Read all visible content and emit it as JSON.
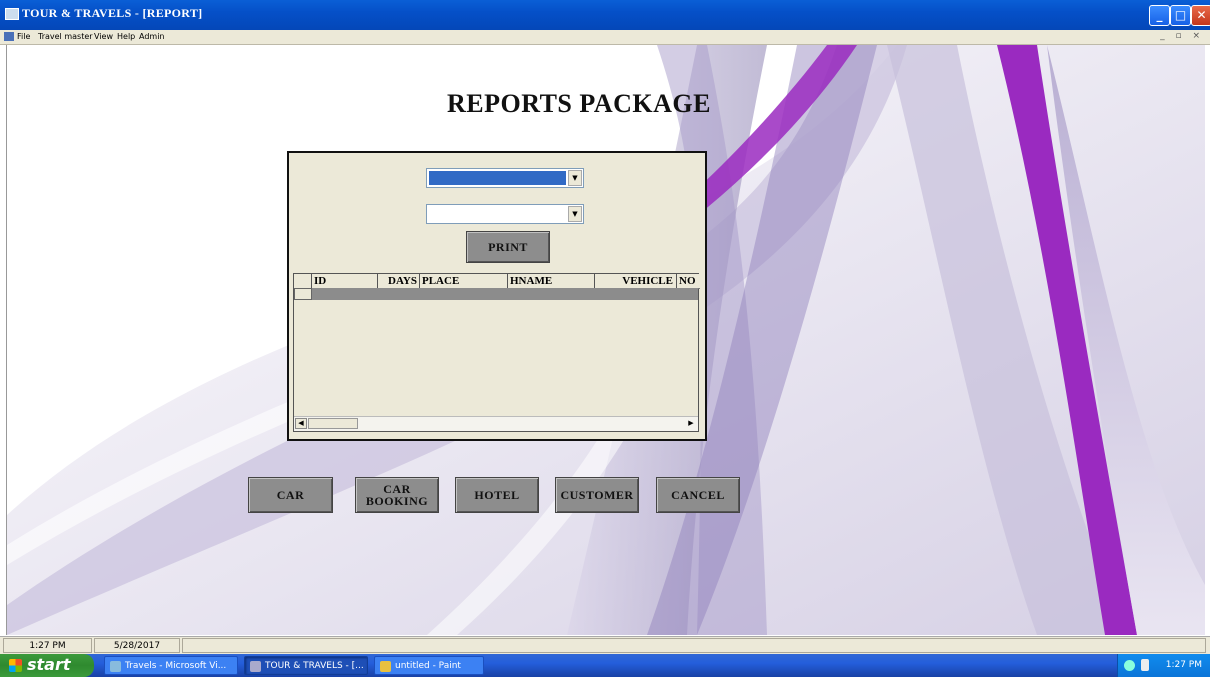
{
  "window": {
    "title": "TOUR & TRAVELS - [REPORT]",
    "controls": {
      "minimize": "_",
      "maximize": "□",
      "close": "✕"
    }
  },
  "menu": {
    "items": [
      "File",
      "Travel master",
      "View",
      "Help",
      "Admin"
    ],
    "mdi_controls": "_ ▫ ×"
  },
  "report": {
    "heading": "REPORTS PACKAGE",
    "combo1": {
      "value": "",
      "highlighted": true
    },
    "combo2": {
      "value": ""
    },
    "print_label": "PRINT",
    "grid": {
      "columns": [
        "ID",
        "DAYS",
        "PLACE",
        "HNAME",
        "VEHICLE",
        "NO"
      ],
      "rows": []
    }
  },
  "nav_buttons": {
    "car": "CAR",
    "car_booking": "CAR\nBOOKING",
    "hotel": "HOTEL",
    "customer": "CUSTOMER",
    "cancel": "CANCEL"
  },
  "statusbar": {
    "time": "1:27 PM",
    "date": "5/28/2017",
    "message": ""
  },
  "taskbar": {
    "start_label": "start",
    "tasks": [
      "Travels - Microsoft Vi...",
      "TOUR & TRAVELS - [...",
      "untitled - Paint"
    ],
    "active_task": 1,
    "clock": "1:27 PM"
  },
  "colors": {
    "titlebar": "#0550c8",
    "button_face": "#8d8d8d",
    "form_face": "#ece9d8",
    "accent_purple": "#9a2ac0"
  }
}
